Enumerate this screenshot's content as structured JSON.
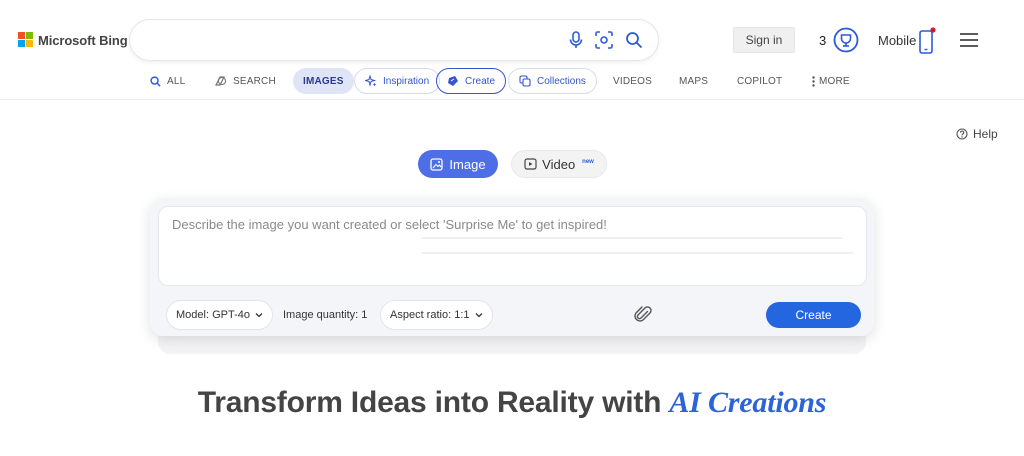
{
  "header": {
    "logo_text": "Microsoft Bing",
    "search": {
      "value": "",
      "placeholder": ""
    },
    "sign_in_label": "Sign in",
    "rewards_count": "3",
    "mobile_label": "Mobile"
  },
  "nav": {
    "tabs": [
      {
        "label": "ALL",
        "icon": "search-icon"
      },
      {
        "label": "SEARCH",
        "icon": "copilot-search-icon"
      },
      {
        "label": "IMAGES",
        "icon": "",
        "active": true
      },
      {
        "label": "Inspiration",
        "icon": "sparkle-icon"
      },
      {
        "label": "Create",
        "icon": "create-icon"
      },
      {
        "label": "Collections",
        "icon": "collections-icon"
      },
      {
        "label": "VIDEOS",
        "icon": ""
      },
      {
        "label": "MAPS",
        "icon": ""
      },
      {
        "label": "COPILOT",
        "icon": ""
      },
      {
        "label": "MORE",
        "icon": "more-vertical-icon"
      }
    ]
  },
  "help_label": "Help",
  "modes": {
    "image_label": "Image",
    "video_label": "Video",
    "video_badge": "new",
    "selected": "Image"
  },
  "prompt": {
    "value": "",
    "placeholder": "Describe the image you want created or select 'Surprise Me' to get inspired!"
  },
  "options": {
    "model_label": "Model: GPT-4o",
    "quantity_label": "Image quantity: 1",
    "aspect_label": "Aspect ratio: 1:1"
  },
  "create_label": "Create",
  "headline": {
    "main": "Transform Ideas into Reality with ",
    "accent": "AI Creations"
  },
  "colors": {
    "brand_blue": "#2466e0",
    "image_mode": "#4e6ee8",
    "accent_text": "#2d63d8",
    "notification_dot": "#d11a2a"
  }
}
